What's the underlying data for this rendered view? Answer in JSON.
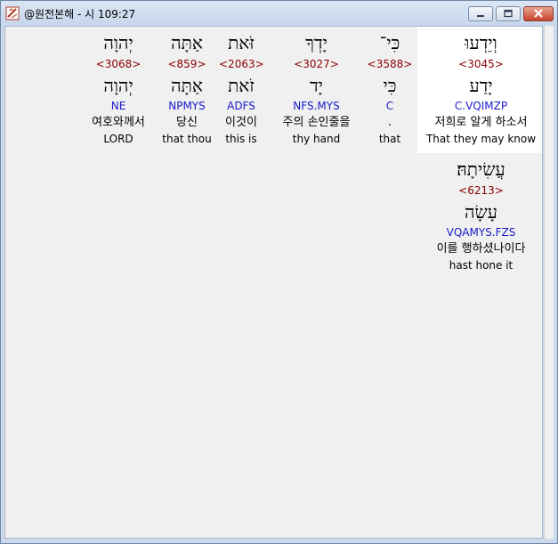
{
  "window": {
    "title": "@원전본해 - 시 109:27"
  },
  "words": [
    {
      "heb_text": "וְיֵדְעוּ",
      "strong": "<3045>",
      "lemma": "יָדַע",
      "morph": "C.VQIMZP",
      "korean": "저희로 알게 하소서",
      "english": "That they may know",
      "selected": true
    },
    {
      "heb_text": "כִּי־",
      "strong": "<3588>",
      "lemma": "כִּי",
      "morph": "C",
      "korean": ".",
      "english": "that",
      "selected": false
    },
    {
      "heb_text": "יָדְךָ",
      "strong": "<3027>",
      "lemma": "יָד",
      "morph": "NFS.MYS",
      "korean": "주의 손인줄을",
      "english": "thy hand",
      "selected": false
    },
    {
      "heb_text": "זֹּאת",
      "strong": "<2063>",
      "lemma": "זֹאת",
      "morph": "ADFS",
      "korean": "이것이",
      "english": "this is",
      "selected": false
    },
    {
      "heb_text": "אַתָּה",
      "strong": "<859>",
      "lemma": "אַתָּה",
      "morph": "NPMYS",
      "korean": "당신",
      "english": "that thou",
      "selected": false
    },
    {
      "heb_text": "יְהוָה",
      "strong": "<3068>",
      "lemma": "יְהוָה",
      "morph": "NE",
      "korean": "여호와께서",
      "english": "LORD",
      "selected": false
    },
    {
      "heb_text": "עֲשִׂיתָהּ׃",
      "strong": "<6213>",
      "lemma": "עָשָׂה",
      "morph": "VQAMYS.FZS",
      "korean": "이를 행하셨나이다",
      "english": "hast hone it",
      "selected": false
    }
  ]
}
